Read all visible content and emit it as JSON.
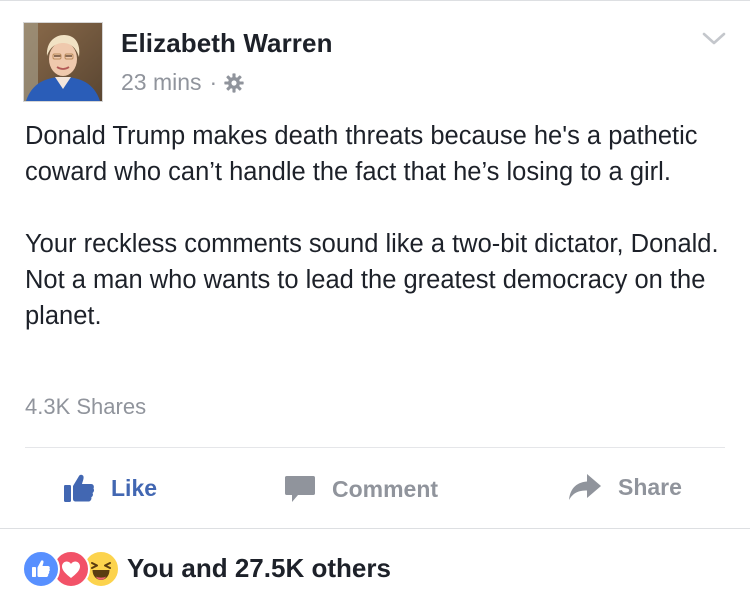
{
  "post": {
    "author": "Elizabeth Warren",
    "time": "23 mins",
    "separator": "·",
    "privacy_icon": "gear-icon",
    "menu_icon": "chevron-down-icon",
    "paragraphs": [
      "Donald Trump makes death threats because he's a pathetic coward who can’t handle the fact that he’s losing to a girl.",
      "Your reckless comments sound like a two-bit dictator, Donald. Not a man who wants to lead the greatest democracy on the planet."
    ],
    "shares": "4.3K Shares"
  },
  "actions": {
    "like_label": "Like",
    "comment_label": "Comment",
    "share_label": "Share"
  },
  "reactions": {
    "icons": [
      "like-icon",
      "love-icon",
      "haha-icon"
    ],
    "summary": "You and 27.5K others"
  },
  "colors": {
    "accent": "#4267b2",
    "text": "#1d2129",
    "muted": "#90949c"
  }
}
